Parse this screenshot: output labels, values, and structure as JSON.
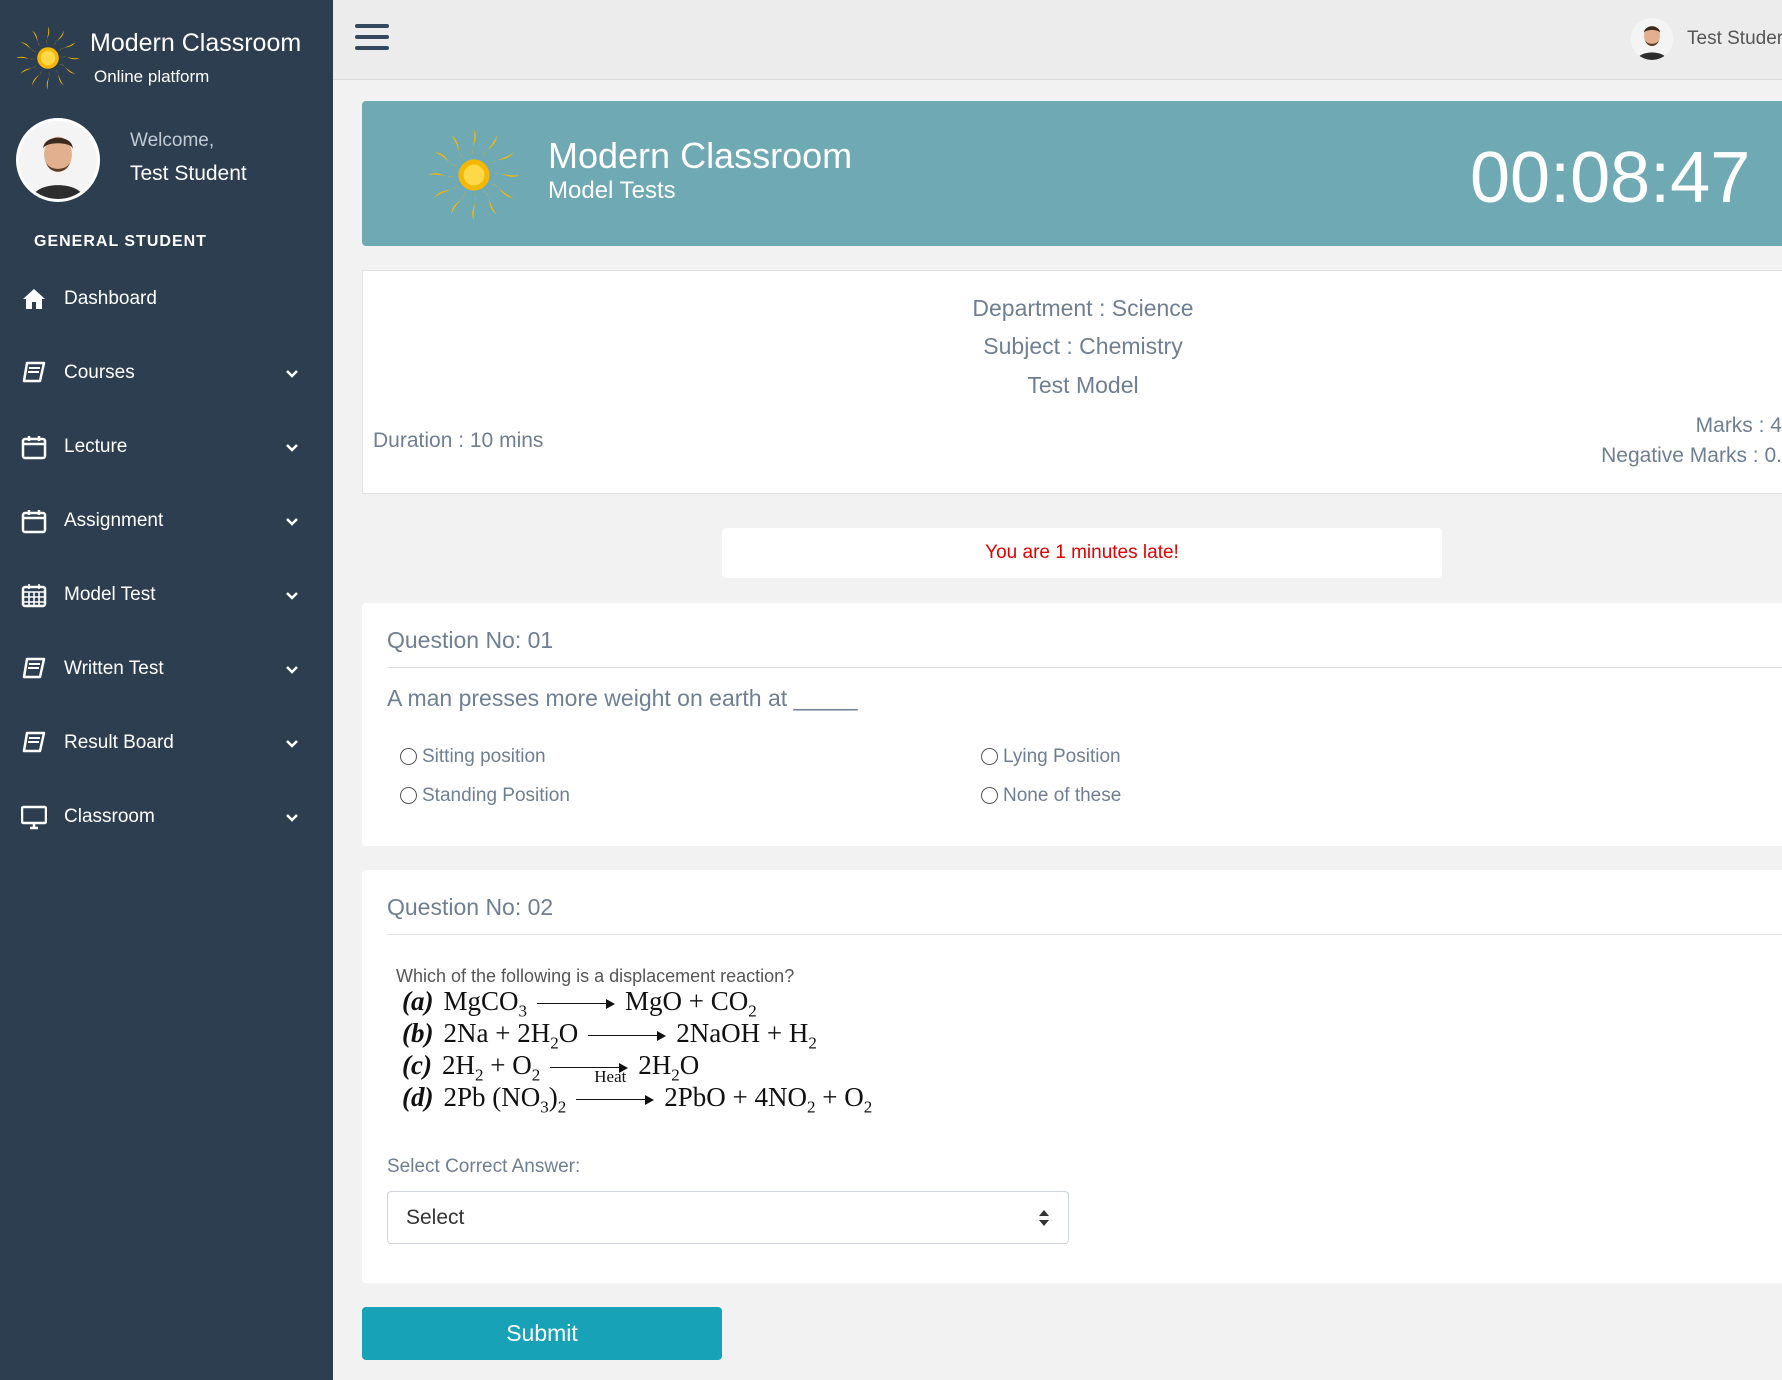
{
  "brand": {
    "title": "Modern Classroom",
    "subtitle": "Online platform",
    "logo_icon": "sun-logo-icon"
  },
  "profile": {
    "welcome": "Welcome,",
    "name": "Test Student",
    "role": "GENERAL STUDENT"
  },
  "sidebar": {
    "items": [
      {
        "label": "Dashboard",
        "icon": "home-icon",
        "has_chevron": false
      },
      {
        "label": "Courses",
        "icon": "book-icon",
        "has_chevron": true
      },
      {
        "label": "Lecture",
        "icon": "calendar-icon",
        "has_chevron": true
      },
      {
        "label": "Assignment",
        "icon": "calendar-icon",
        "has_chevron": true
      },
      {
        "label": "Model Test",
        "icon": "calendar-grid-icon",
        "has_chevron": true
      },
      {
        "label": "Written Test",
        "icon": "book-icon",
        "has_chevron": true
      },
      {
        "label": "Result Board",
        "icon": "book-icon",
        "has_chevron": true
      },
      {
        "label": "Classroom",
        "icon": "monitor-icon",
        "has_chevron": true
      }
    ]
  },
  "topbar": {
    "menu_icon": "hamburger-icon",
    "user_name": "Test Studer"
  },
  "banner": {
    "title": "Modern Classroom",
    "subtitle": "Model Tests",
    "timer": "00:08:47"
  },
  "test_info": {
    "department": "Department : Science",
    "subject": "Subject : Chemistry",
    "model": "Test Model",
    "duration": "Duration : 10 mins",
    "marks": "Marks : 4",
    "negative_marks": "Negative Marks : 0."
  },
  "alert": {
    "late_message": "You are 1 minutes late!"
  },
  "questions": [
    {
      "title": "Question No: 01",
      "text": "A man presses more weight on earth at _____",
      "options": [
        "Sitting position",
        "Lying Position",
        "Standing Position",
        "None of these"
      ]
    },
    {
      "title": "Question No: 02",
      "intro": "Which of the following is a displacement reaction?",
      "reactions": [
        {
          "label": "(a)",
          "left": "MgCO",
          "left_sub": "3",
          "right": "MgO + CO",
          "right_sub": "2"
        },
        {
          "label": "(b)",
          "left": "2Na + 2H",
          "left_sub": "2",
          "left_tail": "O",
          "right": "2NaOH + H",
          "right_sub": "2"
        },
        {
          "label": "(c)",
          "left": "2H",
          "left_sub": "2",
          "left_mid": " + O",
          "left_sub2": "2",
          "right": "2H",
          "right_sub": "2",
          "right_tail": "O"
        },
        {
          "label": "(d)",
          "left": "2Pb (NO",
          "left_sub": "3",
          "left_tail": ")",
          "left_sub2": "2",
          "arrow_label": "Heat",
          "right": "2PbO + 4NO",
          "right_sub": "2",
          "right_tail": " + O",
          "right_sub2": "2"
        }
      ],
      "select_label": "Select Correct Answer:",
      "select_value": "Select"
    }
  ],
  "submit_label": "Submit",
  "colors": {
    "sidebar": "#2c3e50",
    "banner": "#6fa9b3",
    "late": "#e00000",
    "submit": "#17a2b8"
  }
}
